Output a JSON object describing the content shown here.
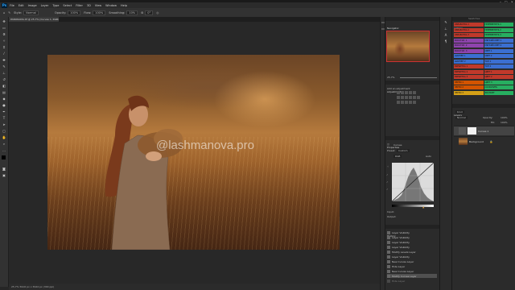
{
  "menu": {
    "items": [
      "File",
      "Edit",
      "Image",
      "Layer",
      "Type",
      "Select",
      "Filter",
      "3D",
      "View",
      "Window",
      "Help"
    ]
  },
  "options": {
    "style_label": "Style:",
    "style_value": "Normal",
    "opacity_label": "Opacity:",
    "opacity_value": "100%",
    "flow_label": "Flow:",
    "flow_value": "100%",
    "smoothing_label": "Smoothing:",
    "smoothing_value": "10%",
    "angle_value": "0°"
  },
  "document": {
    "tab_title": "PANORAMA.tif @ 25.7% (Curves 1, RGB/16*)",
    "watermark": "@lashmanova.pro",
    "status_text": "25.7%   5916 px x 3944 px (300 ppi)"
  },
  "panels": {
    "navigator_title": "Navigator",
    "navigator_zoom": "25.7%",
    "adjustments_title": "Adjustments",
    "adjustments_subtitle": "Add an adjustment",
    "properties_title": "Properties",
    "properties_layer": "Curves",
    "preset_label": "Preset:",
    "preset_value": "Custom",
    "channel_value": "RGB",
    "auto_label": "Auto",
    "input_label": "Input:",
    "output_label": "Output:",
    "history_title": "History",
    "actions_title": "Actions",
    "swatches_title": "Swatches",
    "layers_title": "Layers",
    "kind_label": "Kind",
    "blend_mode": "Normal",
    "opacity_label": "Opacity:",
    "opacity_value": "100%",
    "fill_label": "Fill:",
    "fill_value": "100%"
  },
  "history": {
    "items": [
      "Layer Visibility",
      "Layer Visibility",
      "Layer Visibility",
      "Layer Visibility",
      "Modify Levels Layer",
      "Layer Visibility",
      "New Curves Layer",
      "Hide Layer",
      "New Curves Layer",
      "Modify Curves Layer",
      "Hide Layer"
    ]
  },
  "actions": {
    "rows": [
      [
        "ОБРАБОТКА 1",
        "ПЕРЕВЕРНУТЬ 1"
      ],
      [
        "ОБРАБОТКА 2",
        "ПЕРЕВЕРНУТЬ 2"
      ],
      [
        "ОБРАБОТКА 3",
        "ПЕРЕВЕРНУТЬ 3"
      ],
      [
        "ВОССТАН. 1",
        "МЯГКИЙ СВЕТ 1"
      ],
      [
        "ВОССТАН. 2",
        "МЯГКИЙ СВЕТ 2"
      ],
      [
        "ВОССТАН. 3",
        "СВЕТ 1"
      ],
      [
        "ШАРПЕН 1",
        "СВЕТ 2"
      ],
      [
        "ШАРПЕН 2",
        "ТОН 1"
      ],
      [
        "ВИНЬЕТКА 1",
        "ТОН 2"
      ],
      [
        "ВИНЬЕТКА 2",
        "ЦВЕТ 1"
      ],
      [
        "ВИНЬЕТКА 3",
        "ЦВЕТ 2"
      ],
      [
        "ЗЕРНО 1",
        "ЦВЕТ 3"
      ],
      [
        "ЗЕРНО 2",
        "СОХРАНИТЬ"
      ],
      [
        "ЗЕРНО 3",
        "ЭКСПОРТ"
      ]
    ],
    "colors": [
      "#c0392b",
      "#c0392b",
      "#c0392b",
      "#8e44ad",
      "#8e44ad",
      "#8e44ad",
      "#3b6fd1",
      "#3b6fd1",
      "#c0392b",
      "#c0392b",
      "#c0392b",
      "#d35400",
      "#d35400",
      "#d4a017"
    ],
    "colors_right": [
      "#27ae60",
      "#27ae60",
      "#27ae60",
      "#3b6fd1",
      "#3b6fd1",
      "#3b6fd1",
      "#3b6fd1",
      "#3b6fd1",
      "#3b6fd1",
      "#c0392b",
      "#c0392b",
      "#27ae60",
      "#27ae60",
      "#27ae60"
    ]
  },
  "layers": {
    "items": [
      {
        "name": "Curves 1",
        "thumb": "#f2f2f2"
      },
      {
        "name": "Background",
        "thumb": "#9b5a2a"
      }
    ]
  },
  "colors": {
    "ps_blue": "#31a8ff",
    "selection_red": "#cc3333"
  }
}
